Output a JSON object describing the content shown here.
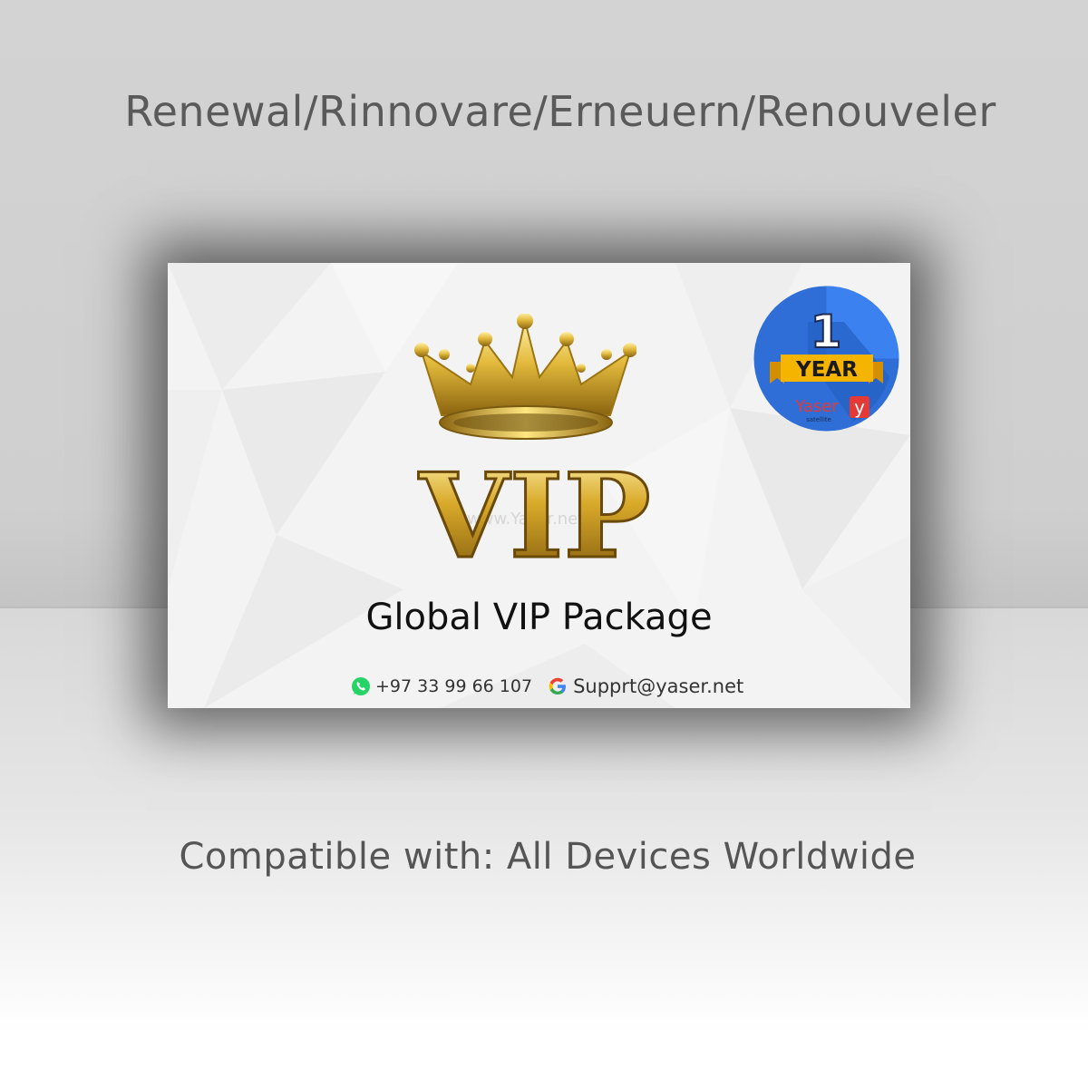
{
  "header": {
    "title": "Renewal/Rinnovare/Erneuern/Renouveler"
  },
  "card": {
    "logo_text": "VIP",
    "watermark": "www.Yaser.net",
    "package_name": "Global VIP Package",
    "contact": {
      "phone": "+97 33 99 66 107",
      "email": "Supprt@yaser.net",
      "phone_icon": "whatsapp-icon",
      "email_icon": "google-icon"
    },
    "badge": {
      "number": "1",
      "label": "YEAR",
      "brand": "Yaser",
      "brand_sub": "satellite",
      "brand_mark": "y"
    }
  },
  "footer": {
    "compatibility": "Compatible with: All Devices Worldwide"
  },
  "colors": {
    "gold": "#c9a227",
    "badge_blue": "#2f6ed6",
    "ribbon_yellow": "#f4b400",
    "brand_red": "#e53935",
    "whatsapp_green": "#25d366"
  }
}
